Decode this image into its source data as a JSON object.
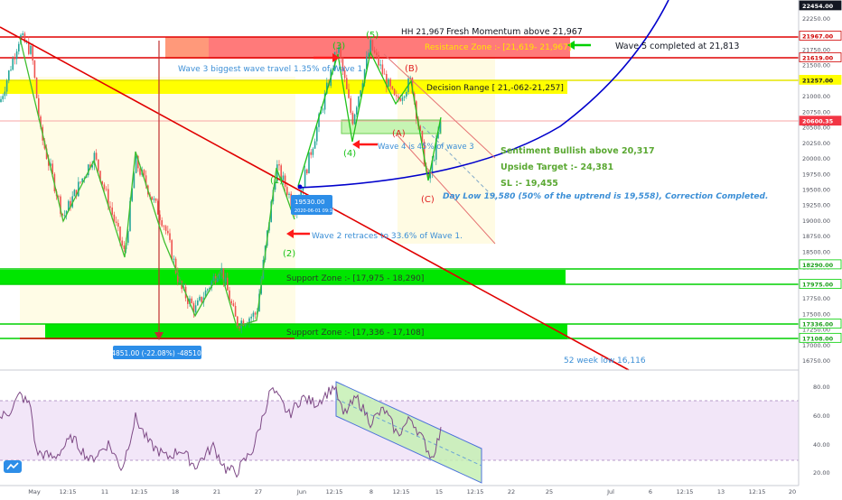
{
  "price_axis": {
    "ticks": [
      "22250.00",
      "22000.00",
      "21750.00",
      "21500.00",
      "21250.00",
      "21000.00",
      "20750.00",
      "20500.00",
      "20250.00",
      "20000.00",
      "19750.00",
      "19500.00",
      "19250.00",
      "19000.00",
      "18750.00",
      "18500.00",
      "18250.00",
      "18000.00",
      "17750.00",
      "17500.00",
      "17250.00",
      "17000.00",
      "16750.00"
    ],
    "tags": [
      {
        "label": "22454.00",
        "bg": "#131722",
        "fg": "#ffffff",
        "value": 22454
      },
      {
        "label": "21967.00",
        "bg": "#ffffff",
        "fg": "#d10000",
        "border": "#d10000",
        "value": 21967
      },
      {
        "label": "21619.00",
        "bg": "#ffffff",
        "fg": "#d10000",
        "border": "#d10000",
        "value": 21619
      },
      {
        "label": "21257.00",
        "bg": "#ffff00",
        "fg": "#131722",
        "value": 21257
      },
      {
        "label": "20600.35",
        "bg": "#f23645",
        "fg": "#ffffff",
        "value": 20600
      },
      {
        "label": "18290.00",
        "bg": "#ffffff",
        "fg": "#1b9e1b",
        "border": "#00d000",
        "value": 18290
      },
      {
        "label": "17975.00",
        "bg": "#ffffff",
        "fg": "#1b9e1b",
        "border": "#00d000",
        "value": 17975
      },
      {
        "label": "17336.00",
        "bg": "#ffffff",
        "fg": "#1b9e1b",
        "border": "#00d000",
        "value": 17336
      },
      {
        "label": "17108.00",
        "bg": "#ffffff",
        "fg": "#1b9e1b",
        "border": "#00d000",
        "value": 17108
      }
    ]
  },
  "rsi_axis": {
    "ticks": [
      "80.00",
      "60.00",
      "40.00",
      "20.00"
    ]
  },
  "time_axis": {
    "ticks": [
      "May",
      "12:15",
      "11",
      "12:15",
      "18",
      "21",
      "27",
      "Jun",
      "12:15",
      "8",
      "12:15",
      "15",
      "12:15",
      "22",
      "25",
      "Jul",
      "6",
      "12:15",
      "13",
      "12:15",
      "20"
    ]
  },
  "annotations": {
    "hh": "HH 21,967",
    "fresh_momentum": "Fresh Momentum above 21,967",
    "resistance_zone": "Resistance Zone :- [21,619- 21,967]",
    "wave5_completed": "Wave 5 completed at 21,813",
    "wave3_travel": "Wave 3  biggest wave travel 1.35% of Wave 1",
    "decision_range": "Decision Range [ 21,-062-21,257]",
    "wave4_note": "Wave 4  is 45% of wave 3",
    "sentiment": "Sentiment Bullish above 20,317",
    "upside_target": "Upside Target :- 24,381",
    "stop_loss": "SL :- 19,455",
    "day_low": "Day Low 19,580 (50% of the uptrend is 19,558), Correction Completed.",
    "wave2_note": "Wave 2 retraces to 33.6% of Wave 1.",
    "support_zone_1": "Support Zone :- [17,975 - 18,290]",
    "support_zone_2": "Support Zone :- [17,336 - 17,108]",
    "week52_low": "52 week  low 16,116",
    "measure": "-4851.00 (-22.08%) -485100",
    "point_price": "19530.00",
    "point_time": "2020-06-01 09:15"
  },
  "wave_labels": {
    "w1": "(1)",
    "w2": "(2)",
    "w3": "(3)",
    "w4": "(4)",
    "w5": "(5)",
    "A": "(A)",
    "B": "(B)",
    "C": "(C)"
  },
  "colors": {
    "up": "#26a69a",
    "down": "#ef5350",
    "resistance": "#ff5050",
    "support": "#00e600",
    "decision": "#ffff00",
    "wave": "#16c216",
    "trend_red": "#e00000",
    "blue_curve": "#0000cc",
    "rsi_line": "#7e4a86",
    "rsi_band": "#e9d5f2",
    "annot_green": "#5aa832",
    "annot_blue": "#3c8fd6"
  },
  "icons": {
    "logo": "tradingview-logo-icon"
  }
}
